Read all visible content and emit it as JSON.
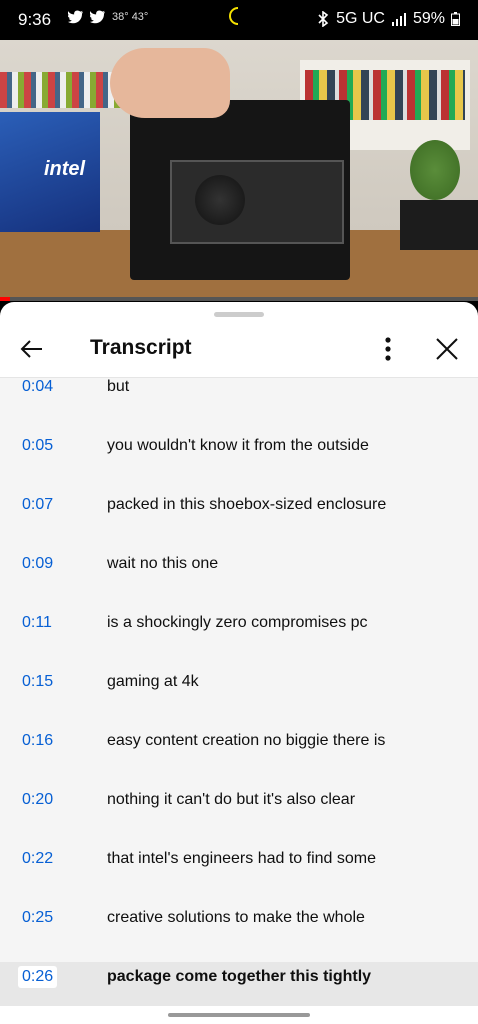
{
  "status_bar": {
    "time": "9:36",
    "temp": "38° 43°",
    "network": "5G UC",
    "battery": "59%"
  },
  "video": {
    "brand_label": "intel",
    "progress_fraction": 0.02
  },
  "transcript_panel": {
    "title": "Transcript",
    "rows": [
      {
        "time": "0:04",
        "text": "but"
      },
      {
        "time": "0:05",
        "text": "you wouldn't know it from the outside"
      },
      {
        "time": "0:07",
        "text": "packed in this shoebox-sized enclosure"
      },
      {
        "time": "0:09",
        "text": "wait no this one"
      },
      {
        "time": "0:11",
        "text": "is a shockingly zero compromises pc"
      },
      {
        "time": "0:15",
        "text": "gaming at 4k"
      },
      {
        "time": "0:16",
        "text": "easy content creation no biggie there is"
      },
      {
        "time": "0:20",
        "text": "nothing it can't do but it's also clear"
      },
      {
        "time": "0:22",
        "text": "that intel's engineers had to find some"
      },
      {
        "time": "0:25",
        "text": "creative solutions to make the whole"
      },
      {
        "time": "0:26",
        "text": "package come together this tightly",
        "active": true
      }
    ]
  },
  "colors": {
    "timestamp": "#065fd4",
    "progress": "#ff0000",
    "active_row": "#e7e7e7"
  }
}
